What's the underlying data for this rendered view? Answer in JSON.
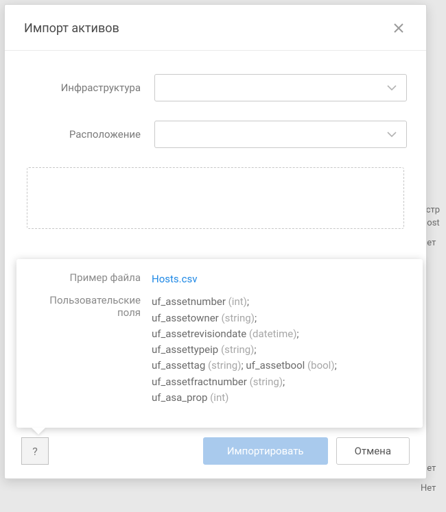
{
  "dialog": {
    "title": "Импорт активов",
    "fields": {
      "infrastructure_label": "Инфраструктура",
      "location_label": "Расположение"
    },
    "footer": {
      "help_label": "?",
      "import_label": "Импортировать",
      "cancel_label": "Отмена"
    }
  },
  "popover": {
    "sample_file_label": "Пример файла",
    "sample_file_link": "Hosts.csv",
    "custom_fields_label": "Пользовательские поля",
    "fields": [
      {
        "name": "uf_assetnumber",
        "type": "int",
        "trail": ";"
      },
      {
        "name": "uf_assetowner",
        "type": "string",
        "trail": ";"
      },
      {
        "name": "uf_assetrevisiondate",
        "type": "datetime",
        "trail": ";"
      },
      {
        "name": "uf_assettypeip",
        "type": "string",
        "trail": ";"
      },
      {
        "name": "uf_assettag",
        "type": "string",
        "trail": "; "
      },
      {
        "name": "uf_assetbool",
        "type": "bool",
        "trail": ";"
      },
      {
        "name": "uf_assetfractnumber",
        "type": "string",
        "trail": ";"
      },
      {
        "name": "uf_asa_prop",
        "type": "int",
        "trail": ""
      }
    ]
  },
  "background": {
    "items": [
      "▸",
      "Устр",
      "Host",
      "Нет",
      "Нет",
      "Нет"
    ]
  }
}
